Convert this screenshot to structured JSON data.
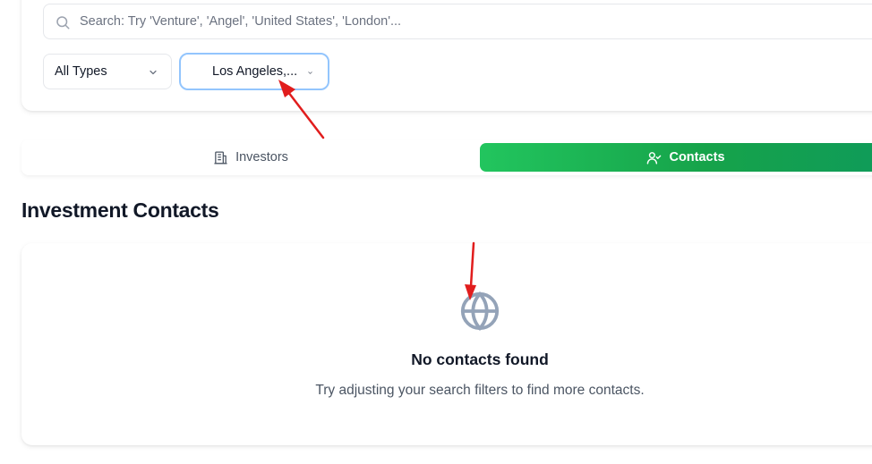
{
  "search": {
    "placeholder": "Search: Try 'Venture', 'Angel', 'United States', 'London'..."
  },
  "filters": {
    "type_value": "All Types",
    "location_value": "Los Angeles,..."
  },
  "tabs": [
    {
      "label": "Investors",
      "icon": "building-icon",
      "active": false
    },
    {
      "label": "Contacts",
      "icon": "user-check-icon",
      "active": true
    }
  ],
  "section": {
    "title": "Investment Contacts"
  },
  "empty_state": {
    "icon": "globe-icon",
    "title": "No contacts found",
    "subtitle": "Try adjusting your search filters to find more contacts."
  },
  "colors": {
    "accent_green": "#22c55e",
    "accent_green_dark": "#0f9b5a",
    "focus_blue": "#93c5fd",
    "annotation_red": "#e11d1d",
    "icon_gray": "#94a3b8"
  }
}
